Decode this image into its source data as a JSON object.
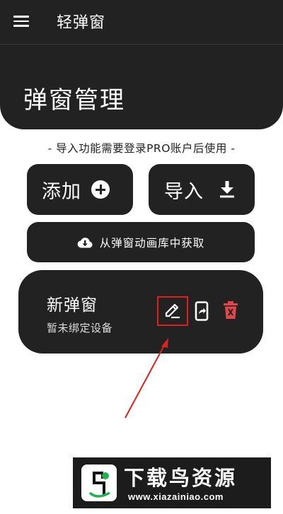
{
  "app": {
    "title": "轻弹窗"
  },
  "page": {
    "title": "弹窗管理"
  },
  "notice": "- 导入功能需要登录PRO账户后使用 -",
  "actions": {
    "add_label": "添加",
    "import_label": "导入",
    "library_label": "从弹窗动画库中获取"
  },
  "popup": {
    "name": "新弹窗",
    "status": "暂未绑定设备"
  },
  "watermark": {
    "title": "下载鸟资源",
    "url": "www.xiazainiao.com"
  },
  "colors": {
    "surface": "#222222",
    "background": "#ffffff",
    "highlight": "#e0201c",
    "delete": "#e0464b",
    "logo_green": "#22b14c"
  },
  "icons": [
    "menu-icon",
    "plus-circle-icon",
    "download-icon",
    "cloud-download-icon",
    "edit-icon",
    "phone-share-icon",
    "trash-icon"
  ]
}
